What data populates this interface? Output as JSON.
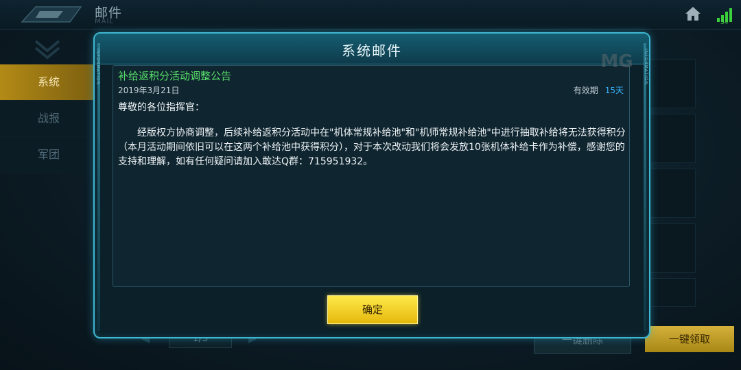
{
  "header": {
    "title": "邮件",
    "subtitle": "MAIL",
    "signal_value": "34"
  },
  "sidebar": {
    "items": [
      {
        "label": "系统",
        "active": true
      },
      {
        "label": "战报",
        "active": false
      },
      {
        "label": "军团",
        "active": false
      }
    ]
  },
  "background": {
    "pager": "1/3",
    "delete_all": "一键删除",
    "claim_all": "一键领取"
  },
  "dialog": {
    "title": "系统邮件",
    "side_tag": "INFORMATION",
    "mail_title": "补给返积分活动调整公告",
    "date": "2019年3月21日",
    "expiry_label": "有效期",
    "expiry_value": "15天",
    "greeting": "尊敬的各位指挥官：",
    "body": "经版权方协商调整，后续补给返积分活动中在\"机体常规补给池\"和\"机师常规补给池\"中进行抽取补给将无法获得积分（本月活动期间依旧可以在这两个补给池中获得积分），对于本次改动我们将会发放10张机体补给卡作为补偿，感谢您的支持和理解，如有任何疑问请加入敢达Q群：715951932。",
    "confirm": "确定"
  },
  "watermark": "MG",
  "colors": {
    "accent": "#3fb7d2",
    "mail_title": "#59e06a",
    "expiry_value": "#38b6ff",
    "confirm_button": "#f2cf22"
  }
}
